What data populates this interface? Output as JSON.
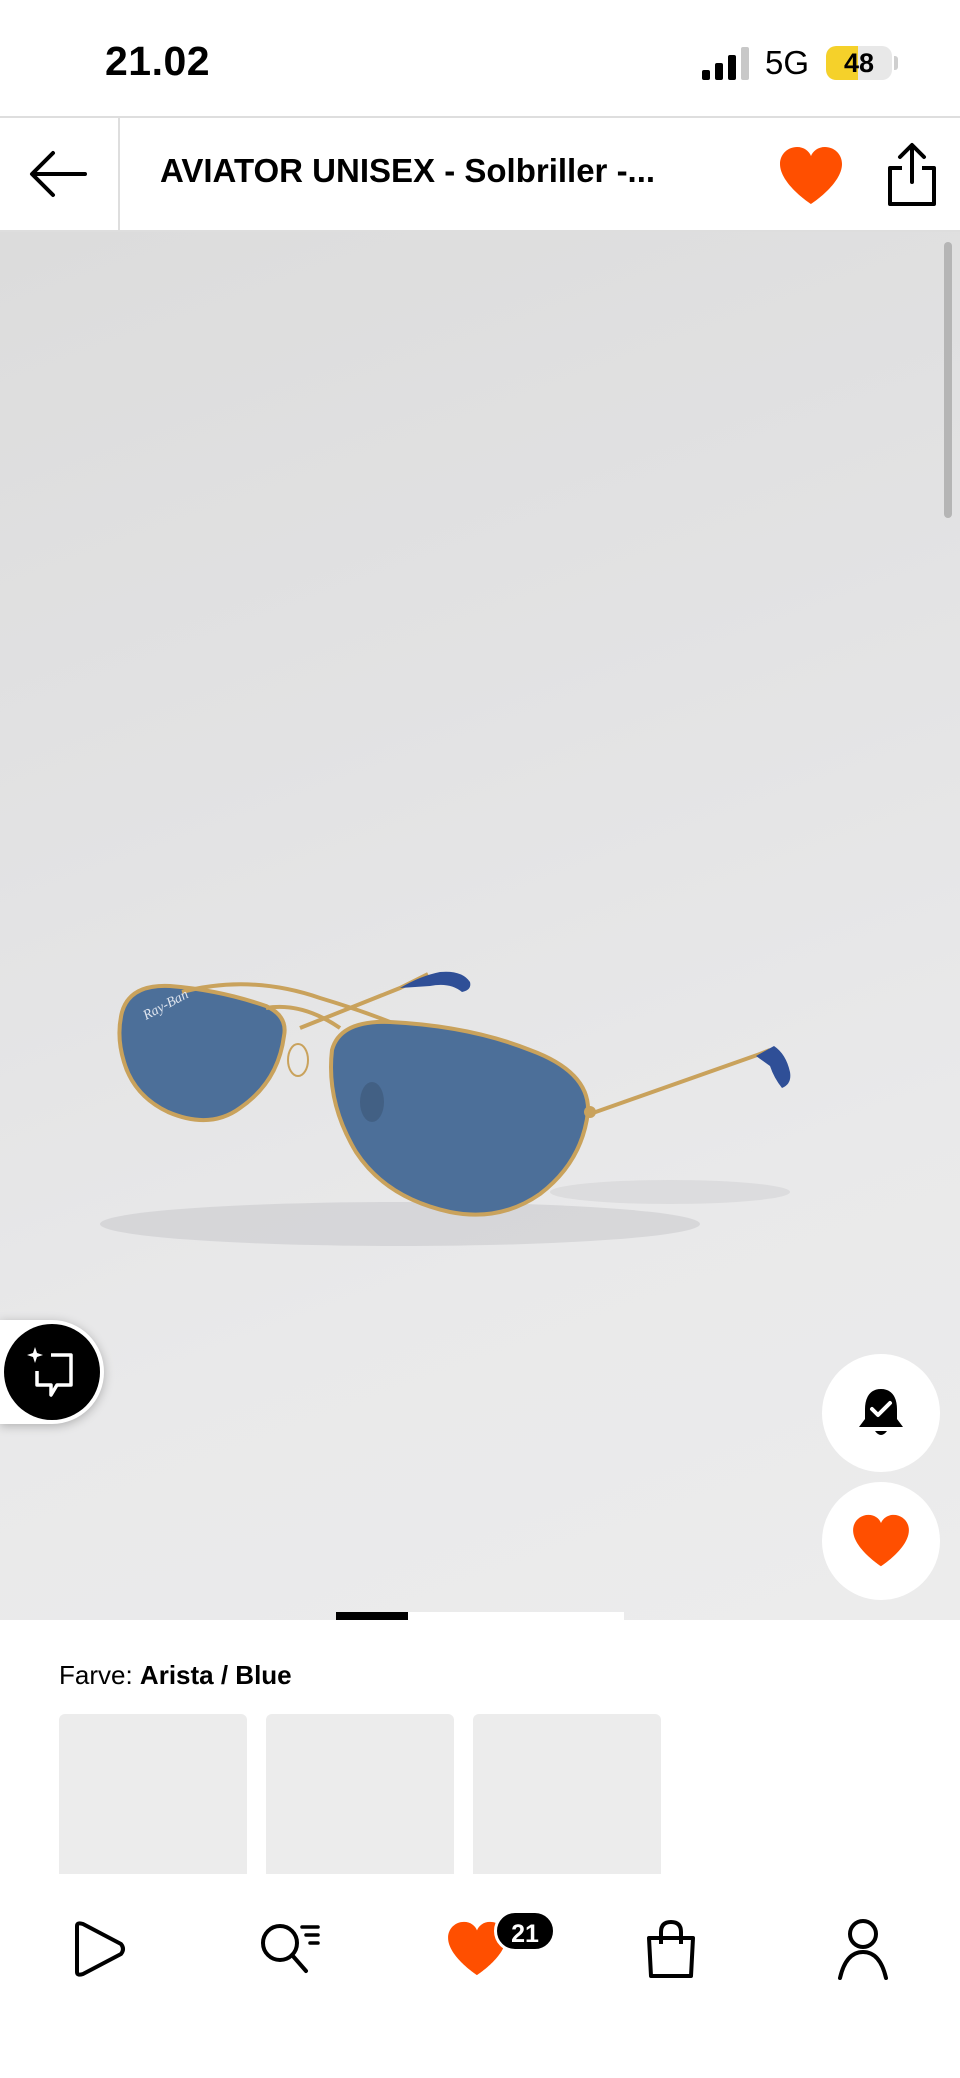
{
  "status_bar": {
    "time": "21.02",
    "network": "5G",
    "battery": "48",
    "battery_level": 0.48,
    "signal_bars": 3
  },
  "header": {
    "title": "AVIATOR UNISEX - Solbriller -...",
    "back_icon": "arrow-left-icon",
    "wishlist_icon": "heart-icon",
    "share_icon": "share-icon"
  },
  "gallery": {
    "image_subject": "aviator-sunglasses",
    "pager_position": 0,
    "pager_count": 6,
    "ai_button_icon": "sparkle-chat-icon",
    "notify_icon": "bell-check-icon",
    "wishlist_icon": "heart-icon"
  },
  "color_selector": {
    "label": "Farve:",
    "value": "Arista / Blue",
    "swatches": [
      {
        "frame_color": "#5a5d62"
      },
      {
        "frame_color": "#b59152"
      },
      {
        "frame_color": "#4b5a63"
      }
    ]
  },
  "bottom_nav": {
    "items": [
      "home-icon",
      "search-icon",
      "wishlist-icon",
      "bag-icon",
      "profile-icon"
    ],
    "wishlist_count": "21"
  },
  "colors": {
    "accent": "#ff4f00",
    "lens": "#4c6f99",
    "frame": "#c9a25c"
  }
}
